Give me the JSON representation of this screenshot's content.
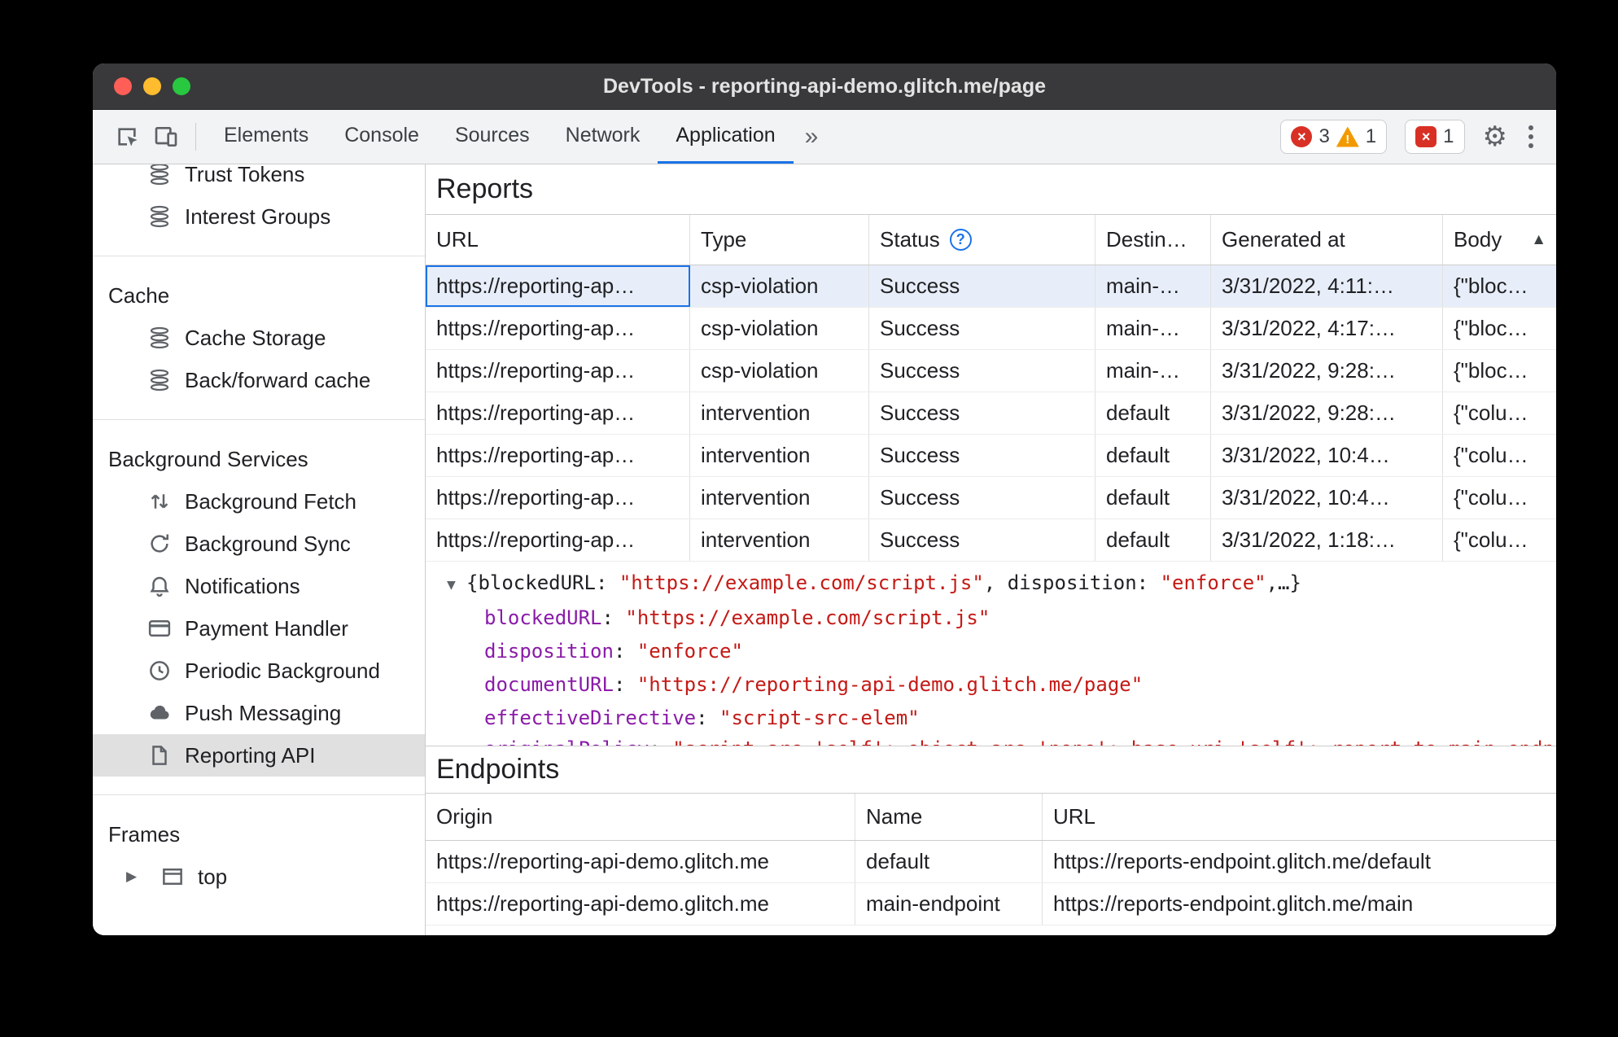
{
  "window": {
    "title": "DevTools - reporting-api-demo.glitch.me/page"
  },
  "colors": {
    "accent": "#1a73e8",
    "error": "#d93025",
    "warning": "#f29900",
    "selected_row": "#e8eef9",
    "titlebar": "#39393b",
    "json_key": "#8a1ba8",
    "json_string": "#c41a16"
  },
  "icons": {
    "toolbar": [
      "inspect-element-icon",
      "device-toolbar-icon",
      "error-icon",
      "warning-icon",
      "issues-icon",
      "settings-gear-icon",
      "more-options-icon"
    ],
    "sidebar": [
      "database-icon",
      "background-fetch-arrows-icon",
      "background-sync-icon",
      "bell-icon",
      "payment-card-icon",
      "clock-icon",
      "cloud-icon",
      "file-icon",
      "frame-icon",
      "disclosure-triangle-icon"
    ]
  },
  "toolbar": {
    "tabs": [
      {
        "label": "Elements"
      },
      {
        "label": "Console"
      },
      {
        "label": "Sources"
      },
      {
        "label": "Network"
      },
      {
        "label": "Application"
      }
    ],
    "more_tabs": "»",
    "badges": {
      "errors": "3",
      "warnings": "1",
      "issues": "1"
    }
  },
  "sidebar": {
    "trust_tokens": "Trust Tokens",
    "interest_groups": "Interest Groups",
    "cache": {
      "header": "Cache",
      "items": [
        "Cache Storage",
        "Back/forward cache"
      ]
    },
    "background": {
      "header": "Background Services",
      "items": [
        "Background Fetch",
        "Background Sync",
        "Notifications",
        "Payment Handler",
        "Periodic Background",
        "Push Messaging",
        "Reporting API"
      ]
    },
    "frames": {
      "header": "Frames",
      "items": [
        "top"
      ]
    }
  },
  "reports": {
    "title": "Reports",
    "columns": [
      "URL",
      "Type",
      "Status",
      "Destin…",
      "Generated at",
      "Body"
    ],
    "status_help": "?",
    "sort_indicator": "▲",
    "rows": [
      {
        "url": "https://reporting-ap…",
        "type": "csp-violation",
        "status": "Success",
        "destination": "main-…",
        "generated_at": "3/31/2022, 4:11:…",
        "body": "{\"bloc…"
      },
      {
        "url": "https://reporting-ap…",
        "type": "csp-violation",
        "status": "Success",
        "destination": "main-…",
        "generated_at": "3/31/2022, 4:17:…",
        "body": "{\"bloc…"
      },
      {
        "url": "https://reporting-ap…",
        "type": "csp-violation",
        "status": "Success",
        "destination": "main-…",
        "generated_at": "3/31/2022, 9:28:…",
        "body": "{\"bloc…"
      },
      {
        "url": "https://reporting-ap…",
        "type": "intervention",
        "status": "Success",
        "destination": "default",
        "generated_at": "3/31/2022, 9:28:…",
        "body": "{\"colu…"
      },
      {
        "url": "https://reporting-ap…",
        "type": "intervention",
        "status": "Success",
        "destination": "default",
        "generated_at": "3/31/2022, 10:4…",
        "body": "{\"colu…"
      },
      {
        "url": "https://reporting-ap…",
        "type": "intervention",
        "status": "Success",
        "destination": "default",
        "generated_at": "3/31/2022, 10:4…",
        "body": "{\"colu…"
      },
      {
        "url": "https://reporting-ap…",
        "type": "intervention",
        "status": "Success",
        "destination": "default",
        "generated_at": "3/31/2022, 1:18:…",
        "body": "{\"colu…"
      }
    ]
  },
  "preview": {
    "toggle": "▼",
    "separator": ": ",
    "summary": {
      "brace_open": "{",
      "key1": "blockedURL",
      "value1": "\"https://example.com/script.js\"",
      "comma": ", ",
      "key2": "disposition",
      "value2": "\"enforce\"",
      "tail": ",…}"
    },
    "properties": [
      {
        "key": "blockedURL",
        "value": "\"https://example.com/script.js\""
      },
      {
        "key": "disposition",
        "value": "\"enforce\""
      },
      {
        "key": "documentURL",
        "value": "\"https://reporting-api-demo.glitch.me/page\""
      },
      {
        "key": "effectiveDirective",
        "value": "\"script-src-elem\""
      }
    ],
    "clipped": {
      "key": "originalPolicy",
      "value": "\"script-src 'self'; object-src 'none'; base-uri 'self'; report-to main-endpoint;\""
    }
  },
  "endpoints": {
    "title": "Endpoints",
    "columns": [
      "Origin",
      "Name",
      "URL"
    ],
    "rows": [
      {
        "origin": "https://reporting-api-demo.glitch.me",
        "name": "default",
        "url": "https://reports-endpoint.glitch.me/default"
      },
      {
        "origin": "https://reporting-api-demo.glitch.me",
        "name": "main-endpoint",
        "url": "https://reports-endpoint.glitch.me/main"
      }
    ]
  }
}
